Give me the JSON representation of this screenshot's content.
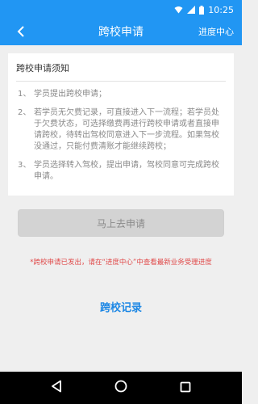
{
  "status_bar": {
    "time": "10:25",
    "icons": [
      "wifi-icon",
      "signal-icon",
      "battery-icon"
    ]
  },
  "app_bar": {
    "back_icon": "chevron-left-icon",
    "title": "跨校申请",
    "action_label": "进度中心"
  },
  "notice": {
    "title": "跨校申请须知",
    "items": [
      {
        "num": "1、",
        "text": "学员提出跨校申请；"
      },
      {
        "num": "2、",
        "text": "若学员无欠费记录，可直接进入下一流程；若学员处于欠费状态，可选择缴费再进行跨校申请或者直接申请跨校，待转出驾校同意进入下一步流程。如果驾校没通过，只能付费清账才能继续跨校；"
      },
      {
        "num": "3、",
        "text": "学员选择转入驾校，提出申请，驾校同意可完成跨校申请。"
      }
    ]
  },
  "apply_button": {
    "label": "马上去申请",
    "enabled": false
  },
  "hint_text": "*跨校申请已发出，请在“进度中心”中查看最新业务受理进度",
  "records_link": "跨校记录",
  "nav_bar": {
    "icons": [
      "back-triangle-icon",
      "home-circle-icon",
      "recents-square-icon"
    ]
  },
  "colors": {
    "primary": "#2196f3",
    "link": "#1e88e5",
    "hint": "#e04848",
    "disabled_button": "#d3d3d3"
  }
}
